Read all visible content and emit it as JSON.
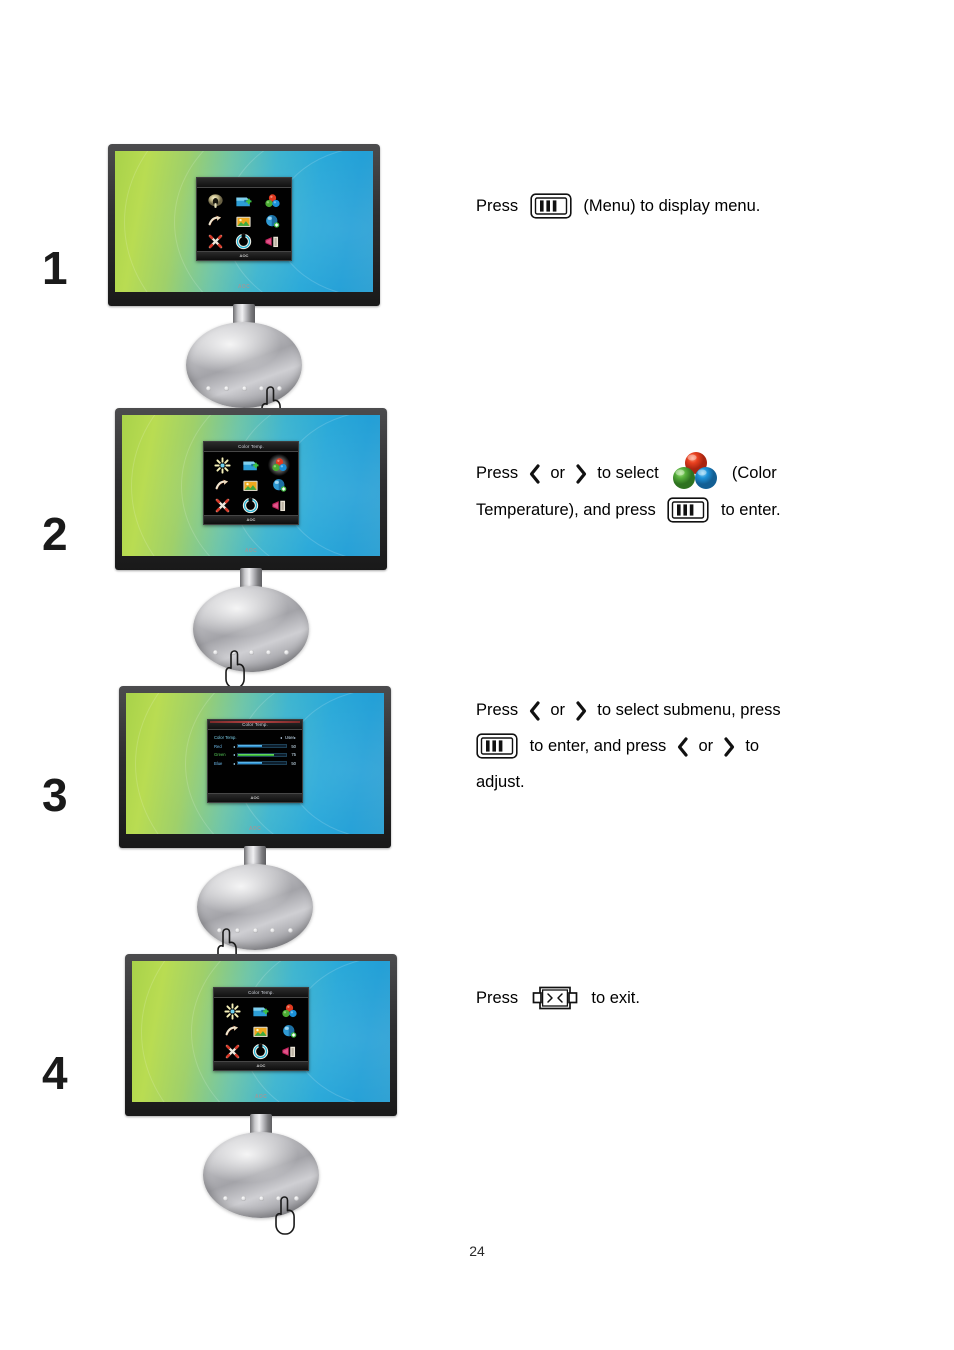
{
  "document": {
    "page_number": "24",
    "brand": "AOC"
  },
  "steps": [
    {
      "number": "1",
      "monitor_state": "main-menu",
      "osd": {
        "title": "",
        "footer_logo": "AOC",
        "selected_index": null,
        "icons": [
          "luminance-icon",
          "image-setup-icon",
          "color-temperature-icon",
          "picture-boost-icon",
          "osd-setup-icon",
          "extra-icon",
          "reset-icon",
          "exit-icon",
          "input-select-icon"
        ]
      },
      "finger_position": "right",
      "text_lines": [
        [
          {
            "type": "text",
            "value": "Press"
          },
          {
            "type": "icon",
            "value": "menu-button-icon"
          },
          {
            "type": "text",
            "value": "(Menu) to display menu."
          }
        ]
      ]
    },
    {
      "number": "2",
      "monitor_state": "main-menu-color-selected",
      "osd": {
        "title": "Color Temp.",
        "footer_logo": "AOC",
        "selected_index": 2,
        "icons": [
          "luminance-icon",
          "image-setup-icon",
          "color-temperature-icon",
          "picture-boost-icon",
          "osd-setup-icon",
          "extra-icon",
          "reset-icon",
          "exit-icon",
          "input-select-icon"
        ]
      },
      "finger_position": "right",
      "text_lines": [
        [
          {
            "type": "text",
            "value": "Press"
          },
          {
            "type": "icon",
            "value": "chevron-left-icon"
          },
          {
            "type": "text",
            "value": "or"
          },
          {
            "type": "icon",
            "value": "chevron-right-icon"
          },
          {
            "type": "text",
            "value": "to select"
          },
          {
            "type": "icon",
            "value": "color-temperature-icon"
          },
          {
            "type": "text",
            "value": "(Color"
          }
        ],
        [
          {
            "type": "text",
            "value": "Temperature), and press"
          },
          {
            "type": "icon",
            "value": "menu-button-icon"
          },
          {
            "type": "text",
            "value": "to enter."
          }
        ]
      ]
    },
    {
      "number": "3",
      "monitor_state": "color-submenu",
      "osd": {
        "title": "Color Temp.",
        "footer_logo": "AOC",
        "header": {
          "label": "Color Temp.",
          "value": "User"
        },
        "sliders": [
          {
            "name": "Red",
            "value": 50,
            "color": "#3ea2e8"
          },
          {
            "name": "Green",
            "value": 75,
            "color": "#3fc93f"
          },
          {
            "name": "Blue",
            "value": 50,
            "color": "#3ea2e8"
          }
        ]
      },
      "finger_position": "left",
      "text_lines": [
        [
          {
            "type": "text",
            "value": "Press"
          },
          {
            "type": "icon",
            "value": "chevron-left-icon"
          },
          {
            "type": "text",
            "value": "or"
          },
          {
            "type": "icon",
            "value": "chevron-right-icon"
          },
          {
            "type": "text",
            "value": "to select submenu, press"
          }
        ],
        [
          {
            "type": "icon",
            "value": "menu-button-icon"
          },
          {
            "type": "text",
            "value": "to enter, and press"
          },
          {
            "type": "icon",
            "value": "chevron-left-icon"
          },
          {
            "type": "text",
            "value": "or"
          },
          {
            "type": "icon",
            "value": "chevron-right-icon"
          },
          {
            "type": "text",
            "value": "to"
          }
        ],
        [
          {
            "type": "text",
            "value": "adjust."
          }
        ]
      ]
    },
    {
      "number": "4",
      "monitor_state": "main-menu",
      "osd": {
        "title": "Color Temp.",
        "footer_logo": "AOC",
        "selected_index": null,
        "icons": [
          "luminance-icon",
          "image-setup-icon",
          "color-temperature-icon",
          "picture-boost-icon",
          "osd-setup-icon",
          "extra-icon",
          "reset-icon",
          "exit-icon",
          "input-select-icon"
        ]
      },
      "finger_position": "right",
      "text_lines": [
        [
          {
            "type": "text",
            "value": "Press"
          },
          {
            "type": "icon",
            "value": "exit-button-icon"
          },
          {
            "type": "text",
            "value": "to exit."
          }
        ]
      ]
    }
  ],
  "colors": {
    "wallpaper_left": "#a8d24a",
    "wallpaper_right": "#1f9ed6",
    "bezel": "#2e2e30",
    "osd_background": "#050505",
    "rgb_red": "#e03a20",
    "rgb_green": "#4bab33",
    "rgb_blue": "#1a8fd8",
    "slider_blue": "#3ea2e8",
    "slider_green": "#3fc93f",
    "text": "#000000"
  }
}
